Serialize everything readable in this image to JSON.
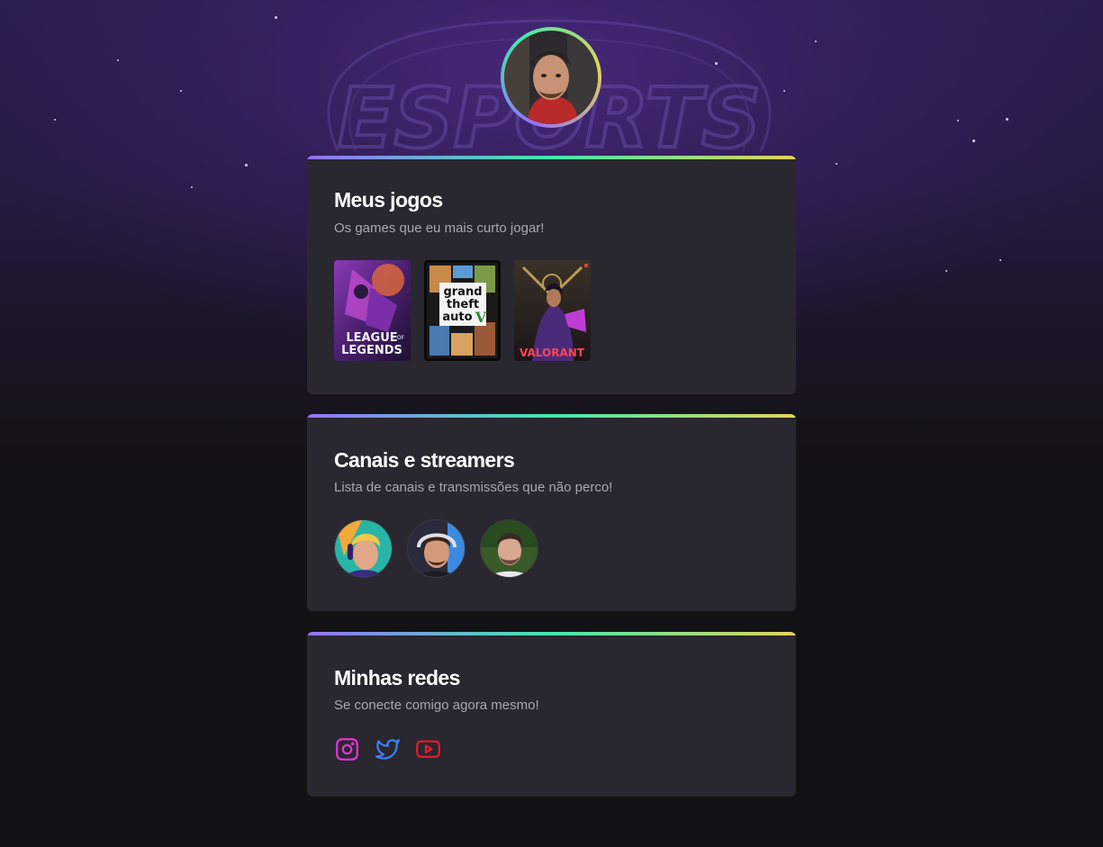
{
  "profile": {
    "avatar_icon": "user-avatar-photo",
    "background_logo_text": "ESPORTS"
  },
  "cards": [
    {
      "title": "Meus jogos",
      "subtitle": "Os games que eu mais curto jogar!",
      "games": [
        {
          "name": "League of Legends",
          "label_line1": "LEAGUE",
          "label_of": "OF",
          "label_line2": "LEGENDS"
        },
        {
          "name": "Grand Theft Auto V",
          "label_line1": "grand",
          "label_line2": "theft",
          "label_line3": "auto",
          "label_num": "V"
        },
        {
          "name": "Valorant",
          "label": "VALORANT"
        }
      ]
    },
    {
      "title": "Canais e streamers",
      "subtitle": "Lista de canais e transmissões que não perco!",
      "streamers": [
        {
          "icon": "streamer-avatar-1"
        },
        {
          "icon": "streamer-avatar-2"
        },
        {
          "icon": "streamer-avatar-3"
        }
      ]
    },
    {
      "title": "Minhas redes",
      "subtitle": "Se conecte comigo agora mesmo!",
      "socials": [
        {
          "name": "instagram",
          "icon": "instagram-icon",
          "color": "#e135d3"
        },
        {
          "name": "twitter",
          "icon": "twitter-icon",
          "color": "#3b82f6"
        },
        {
          "name": "youtube",
          "icon": "youtube-icon",
          "color": "#e11d2b"
        }
      ]
    }
  ],
  "colors": {
    "background": "#121214",
    "card": "#29272f",
    "gradient_start": "#9572fc",
    "gradient_mid": "#43e7ad",
    "gradient_end": "#e2d45c",
    "title": "#ffffff",
    "subtitle": "#a8a8b3"
  }
}
